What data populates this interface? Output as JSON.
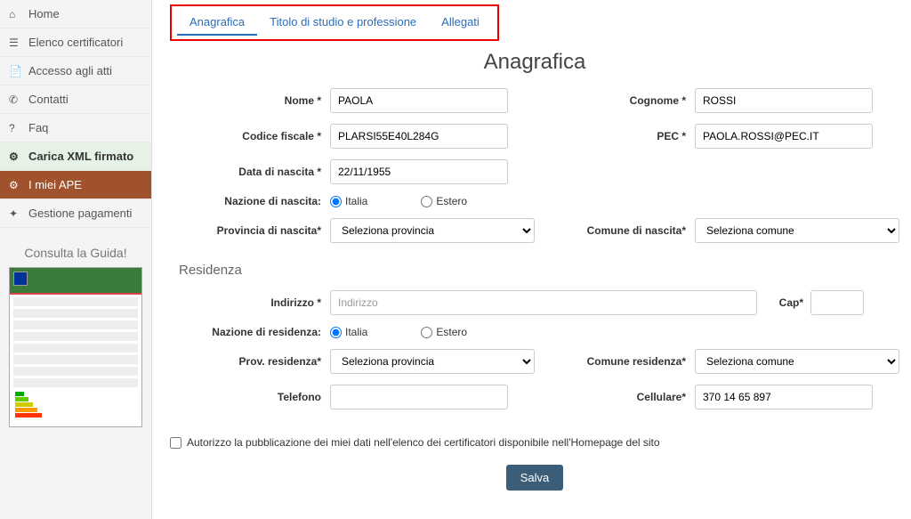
{
  "sidebar": {
    "items": [
      {
        "icon": "⌂",
        "label": "Home"
      },
      {
        "icon": "☰",
        "label": "Elenco certificatori"
      },
      {
        "icon": "📄",
        "label": "Accesso agli atti"
      },
      {
        "icon": "✆",
        "label": "Contatti"
      },
      {
        "icon": "?",
        "label": "Faq"
      },
      {
        "icon": "⚙",
        "label": "Carica XML firmato"
      },
      {
        "icon": "⚙",
        "label": "I miei APE"
      },
      {
        "icon": "✦",
        "label": "Gestione pagamenti"
      }
    ]
  },
  "guide": {
    "title": "Consulta la Guida!"
  },
  "tabs": [
    {
      "label": "Anagrafica"
    },
    {
      "label": "Titolo di studio e professione"
    },
    {
      "label": "Allegati"
    }
  ],
  "page_title": "Anagrafica",
  "labels": {
    "nome": "Nome *",
    "cognome": "Cognome *",
    "cf": "Codice fiscale *",
    "pec": "PEC *",
    "dob": "Data di nascita *",
    "naz_nascita": "Nazione di nascita:",
    "prov_nascita": "Provincia di nascita*",
    "com_nascita": "Comune di nascita*",
    "residenza": "Residenza",
    "indirizzo": "Indirizzo *",
    "cap": "Cap*",
    "naz_res": "Nazione di residenza:",
    "prov_res": "Prov. residenza*",
    "com_res": "Comune residenza*",
    "telefono": "Telefono",
    "cellulare": "Cellulare*",
    "italia": "Italia",
    "estero": "Estero",
    "sel_prov": "Seleziona provincia",
    "sel_com": "Seleziona comune",
    "indirizzo_ph": "Indirizzo",
    "checkbox": "Autorizzo la pubblicazione dei miei dati nell'elenco dei certificatori disponibile nell'Homepage del sito",
    "salva": "Salva"
  },
  "values": {
    "nome": "PAOLA",
    "cognome": "ROSSI",
    "cf": "PLARSI55E40L284G",
    "pec": "PAOLA.ROSSI@PEC.IT",
    "dob": "22/11/1955",
    "cellulare": "370 14 65 897"
  }
}
